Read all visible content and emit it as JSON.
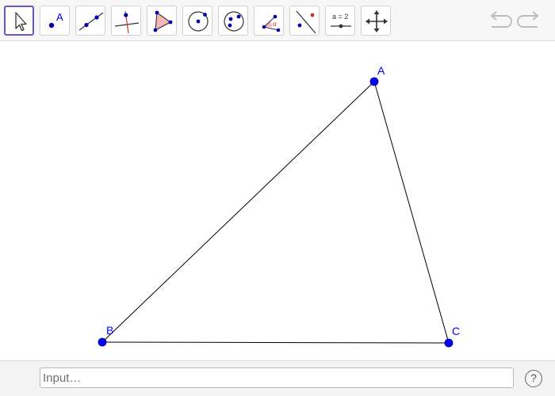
{
  "toolbar": {
    "tools": [
      {
        "id": "move",
        "icon": "move-pointer-icon",
        "selected": true
      },
      {
        "id": "point",
        "icon": "point-icon",
        "label": "A"
      },
      {
        "id": "line",
        "icon": "line-through-two-points-icon"
      },
      {
        "id": "perpendicular",
        "icon": "perpendicular-line-icon"
      },
      {
        "id": "polygon",
        "icon": "polygon-icon"
      },
      {
        "id": "circle",
        "icon": "circle-center-point-icon"
      },
      {
        "id": "circle-three-points",
        "icon": "circle-through-three-points-icon"
      },
      {
        "id": "angle",
        "icon": "angle-icon",
        "label": "α"
      },
      {
        "id": "reflect",
        "icon": "reflect-about-line-icon"
      },
      {
        "id": "slider",
        "icon": "slider-icon",
        "label": "a = 2"
      },
      {
        "id": "move-graphics",
        "icon": "move-graphics-view-icon"
      }
    ],
    "undo_icon": "undo-icon",
    "redo_icon": "redo-icon"
  },
  "construction": {
    "points": [
      {
        "name": "A",
        "label": "A"
      },
      {
        "name": "B",
        "label": "B"
      },
      {
        "name": "C",
        "label": "C"
      }
    ],
    "segments": [
      [
        "A",
        "B"
      ],
      [
        "B",
        "C"
      ],
      [
        "C",
        "A"
      ]
    ],
    "point_color": "#0000ff",
    "segment_color": "#000000"
  },
  "input_bar": {
    "placeholder": "Input…",
    "value": "",
    "help_label": "?"
  },
  "colors": {
    "accent": "#6557d2",
    "toolbar_bg": "#f7f7f7",
    "point": "#0000ff",
    "polygon_fill": "#f4b6b6"
  }
}
